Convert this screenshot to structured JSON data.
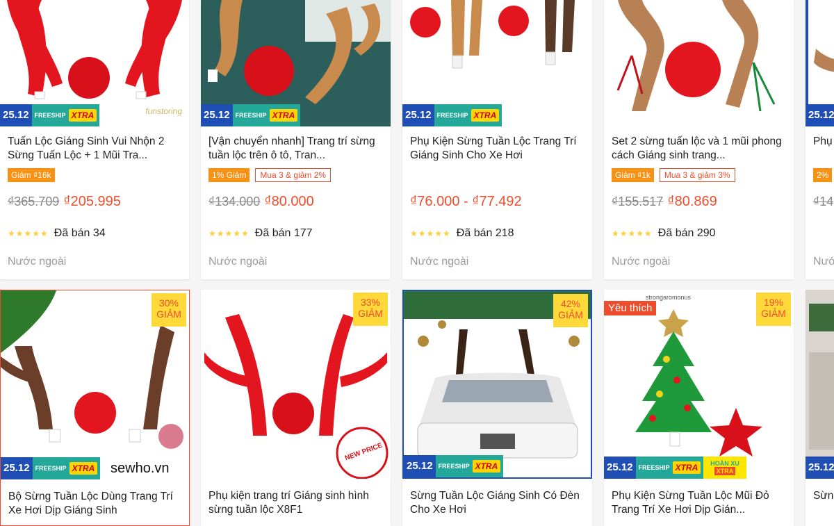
{
  "cards": [
    {
      "title": "Tuấn Lộc Giáng Sinh Vui Nhộn 2 Sừng Tuấn Lộc + 1 Mũi Tra...",
      "tag1": "Giảm ₫16k",
      "tag2": "",
      "old": "₫365.709",
      "price": "₫205.995",
      "sold": "Đã bán 34",
      "loc": "Nước ngoài",
      "date": "25.12",
      "freeship": "FREESHIP",
      "xtra": "XTRA",
      "watermark": "funstoring"
    },
    {
      "title": "[Vận chuyển nhanh] Trang trí sừng tuần lộc trên ô tô, Tran...",
      "tag1": "1% Giảm",
      "tag2": "Mua 3 & giảm 2%",
      "old": "₫134.000",
      "price": "₫80.000",
      "sold": "Đã bán 177",
      "loc": "Nước ngoài",
      "date": "25.12",
      "freeship": "FREESHIP",
      "xtra": "XTRA"
    },
    {
      "title": "Phụ Kiện Sừng Tuần Lộc Trang Trí Giáng Sinh Cho Xe Hơi",
      "price": "₫76.000 - ₫77.492",
      "sold": "Đã bán 218",
      "loc": "Nước ngoài",
      "date": "25.12",
      "freeship": "FREESHIP",
      "xtra": "XTRA"
    },
    {
      "title": "Set 2 sừng tuấn lộc và 1 mũi phong cách Giáng sinh trang...",
      "tag1": "Giảm ₫1k",
      "tag2": "Mua 3 & giảm 3%",
      "old": "₫155.517",
      "price": "₫80.869",
      "sold": "Đã bán 290",
      "loc": "Nước ngoài"
    },
    {
      "title": "Phụ Tran",
      "tag1": "2%",
      "old": "₫14",
      "loc": "Nước",
      "date": "25.12"
    },
    {
      "title": "Bộ Sừng Tuần Lộc Dùng Trang Trí Xe Hơi Dịp Giáng Sinh",
      "disc_pct": "30%",
      "disc_word": "GIẢM",
      "date": "25.12",
      "freeship": "FREESHIP",
      "xtra": "XTRA",
      "watermark": "sewho.vn"
    },
    {
      "title": "Phụ kiện trang trí Giáng sinh hình sừng tuần lộc X8F1",
      "disc_pct": "33%",
      "disc_word": "GIẢM",
      "stamp": "NEW PRICE"
    },
    {
      "title": "Sừng Tuần Lộc Giáng Sinh Có Đèn Cho Xe Hơi",
      "disc_pct": "42%",
      "disc_word": "GIẢM",
      "date": "25.12",
      "freeship": "FREESHIP",
      "xtra": "XTRA"
    },
    {
      "title": "Phụ Kiện Sừng Tuần Lộc Mũi Đỏ Trang Trí Xe Hơi Dịp Gián...",
      "disc_pct": "19%",
      "disc_word": "GIẢM",
      "fav": "Yêu thích",
      "date": "25.12",
      "freeship": "FREESHIP",
      "xtra": "XTRA",
      "hoanxu": "HOÀN XU",
      "hx_xtra": "XTRA",
      "watermark": "strongaromonus"
    },
    {
      "title": "Sừn",
      "date": "25.12"
    }
  ],
  "colors": {
    "accent": "#ee4d2d",
    "freeship": "#23a89a",
    "date_badge": "#1f4fb5",
    "xtra": "#ffd400"
  }
}
